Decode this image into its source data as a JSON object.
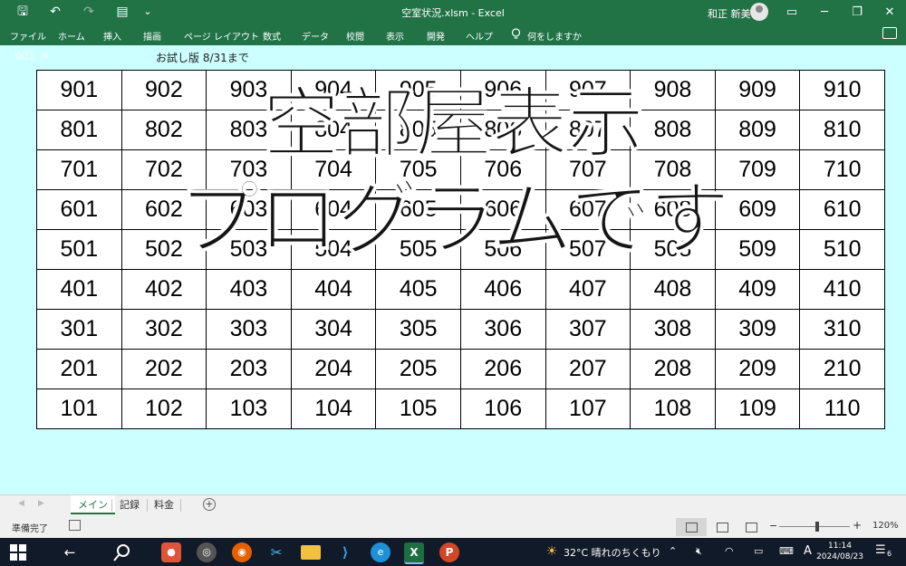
{
  "titlebar": {
    "title": "空室状況.xlsm  -  Excel",
    "user": "和正 新美",
    "quick_access": {
      "save": "🖫",
      "undo": "↶",
      "redo": "↷",
      "form": "▤",
      "customize": "⌄"
    },
    "window_controls": {
      "ribbon_display": "▭",
      "minimize": "─",
      "restore": "❐",
      "close": "✕"
    }
  },
  "ribbon": {
    "tabs": [
      "ファイル",
      "ホーム",
      "挿入",
      "描画",
      "ページ レイアウト",
      "数式",
      "データ",
      "校閲",
      "表示",
      "開発",
      "ヘルプ"
    ],
    "tell_me": "何をしますか",
    "tell_me_icon": "lightbulb-icon"
  },
  "sheet": {
    "background": "#ccffff",
    "trial_text": "お試し版 8/31まで",
    "ghost_text": "901 メ",
    "rooms": [
      [
        "901",
        "902",
        "903",
        "904",
        "905",
        "906",
        "907",
        "908",
        "909",
        "910"
      ],
      [
        "801",
        "802",
        "803",
        "804",
        "805",
        "806",
        "807",
        "808",
        "809",
        "810"
      ],
      [
        "701",
        "702",
        "703",
        "704",
        "705",
        "706",
        "707",
        "708",
        "709",
        "710"
      ],
      [
        "601",
        "602",
        "603",
        "604",
        "605",
        "606",
        "607",
        "608",
        "609",
        "610"
      ],
      [
        "501",
        "502",
        "503",
        "504",
        "505",
        "506",
        "507",
        "508",
        "509",
        "510"
      ],
      [
        "401",
        "402",
        "403",
        "404",
        "405",
        "406",
        "407",
        "408",
        "409",
        "410"
      ],
      [
        "301",
        "302",
        "303",
        "304",
        "305",
        "306",
        "307",
        "308",
        "309",
        "310"
      ],
      [
        "201",
        "202",
        "203",
        "204",
        "205",
        "206",
        "207",
        "208",
        "209",
        "210"
      ],
      [
        "101",
        "102",
        "103",
        "104",
        "105",
        "106",
        "107",
        "108",
        "109",
        "110"
      ]
    ],
    "overlay_line1": "空部屋表示",
    "overlay_line2": "プログラムです"
  },
  "sheet_tabs": {
    "tabs": [
      "メイン",
      "記録",
      "料金"
    ],
    "active": "メイン",
    "add": "+"
  },
  "status": {
    "ready": "準備完了",
    "zoom": "120%",
    "zoom_minus": "−",
    "zoom_plus": "+",
    "zoom_level_percent": 120,
    "active_view": "normal"
  },
  "taskbar": {
    "weather": "32°C  晴れのちくもり",
    "time": "11:14",
    "date": "2024/08/23",
    "ime": "A",
    "notification_count": "6",
    "icons": [
      "windows-start-icon",
      "back-arrow-icon",
      "search-icon",
      "app-icon",
      "game-icon",
      "firefox-icon",
      "snip-icon",
      "file-explorer-icon",
      "vscode-icon",
      "edge-icon",
      "excel-icon",
      "powerpoint-icon"
    ],
    "accent": "#217346"
  }
}
